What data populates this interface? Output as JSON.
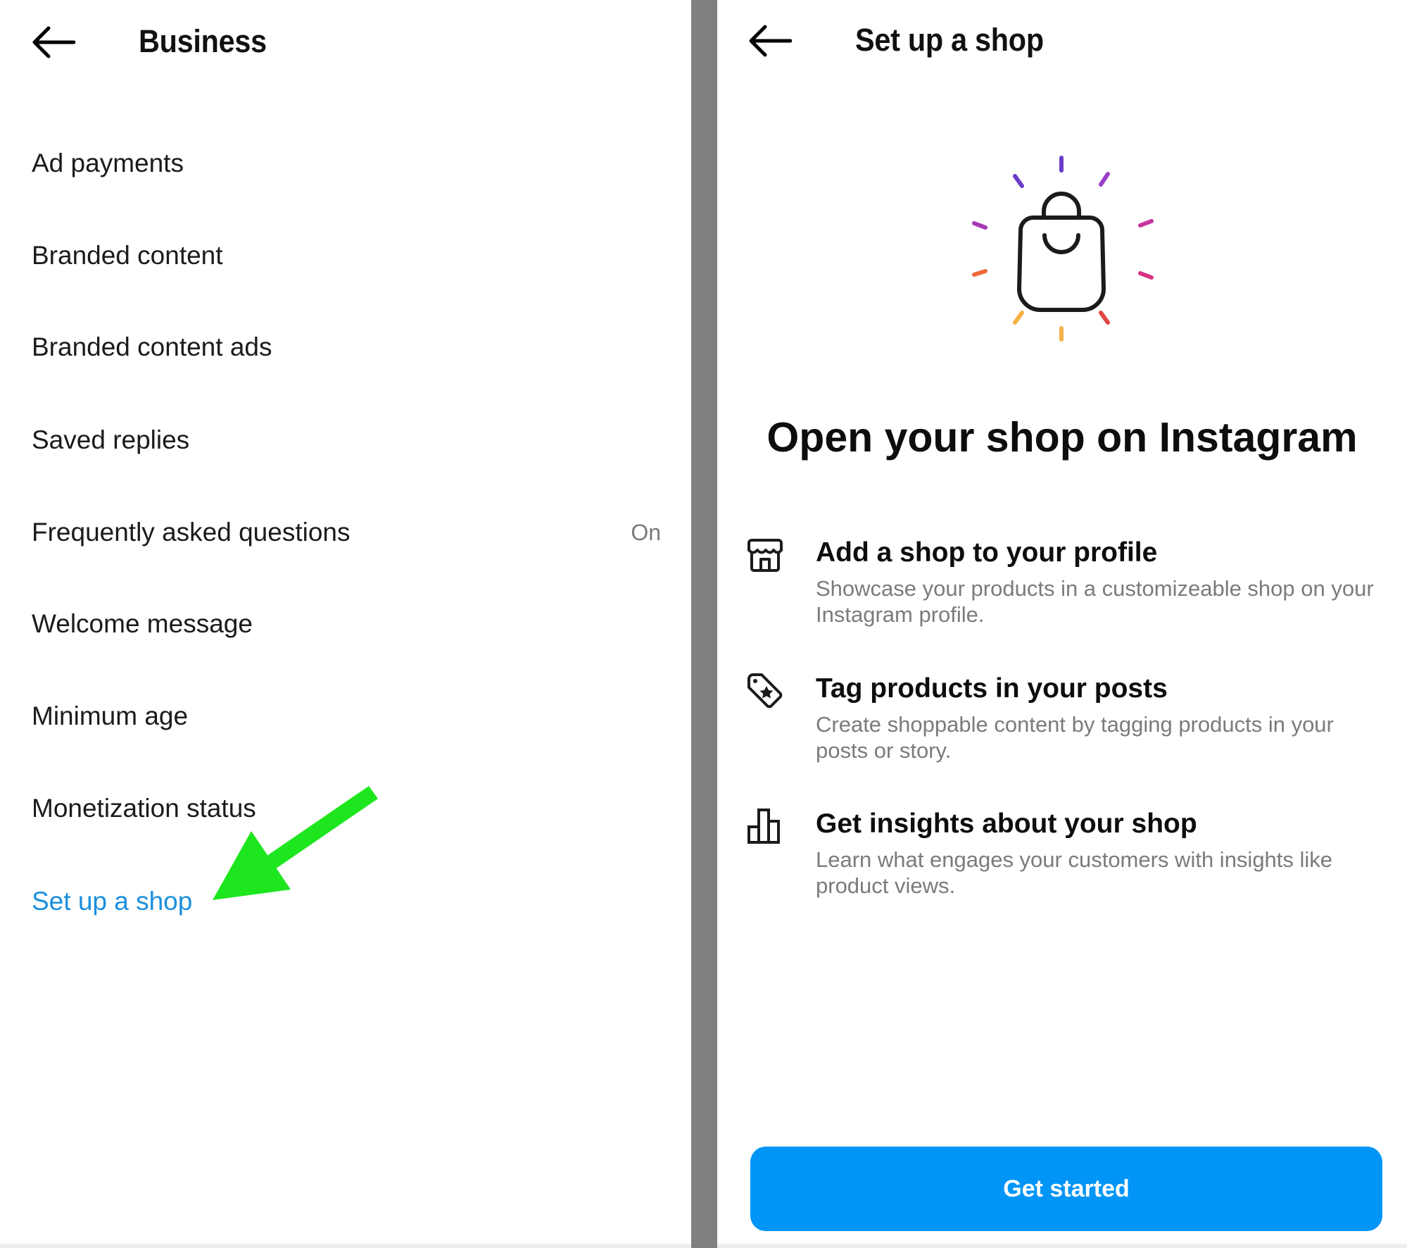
{
  "left": {
    "header": {
      "title": "Business",
      "back_icon": "arrow-left-icon"
    },
    "items": [
      {
        "label": "Ad payments",
        "value": ""
      },
      {
        "label": "Branded content",
        "value": ""
      },
      {
        "label": "Branded content ads",
        "value": ""
      },
      {
        "label": "Saved replies",
        "value": ""
      },
      {
        "label": "Frequently asked questions",
        "value": "On"
      },
      {
        "label": "Welcome message",
        "value": ""
      },
      {
        "label": "Minimum age",
        "value": ""
      },
      {
        "label": "Monetization status",
        "value": ""
      },
      {
        "label": "Set up a shop",
        "value": "",
        "highlighted": true
      }
    ],
    "link_color": "#1a8fdd",
    "annotation": {
      "type": "green-arrow",
      "color": "#1ee61e",
      "points_to": "Set up a shop"
    }
  },
  "right": {
    "header": {
      "title": "Set up a shop",
      "back_icon": "arrow-left-icon"
    },
    "hero_icon": "shopping-bag-icon",
    "hero_title": "Open your shop on Instagram",
    "features": [
      {
        "icon": "storefront-icon",
        "title": "Add a shop to your profile",
        "description": "Showcase your products in a customizeable shop on your Instagram profile."
      },
      {
        "icon": "tag-star-icon",
        "title": "Tag products in your posts",
        "description": "Create shoppable content by tagging products in your posts or story."
      },
      {
        "icon": "bar-chart-icon",
        "title": "Get insights about your shop",
        "description": "Learn what engages your customers with insights like product views."
      }
    ],
    "cta": {
      "label": "Get started",
      "color": "#0095f6"
    }
  },
  "divider_color": "#808080"
}
